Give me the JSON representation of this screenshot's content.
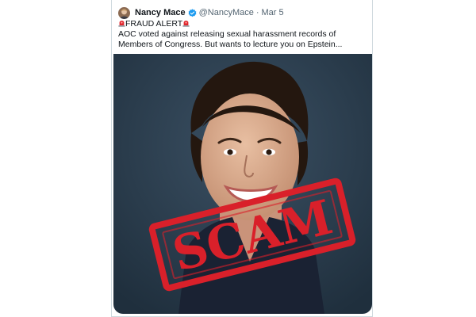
{
  "tweet": {
    "author": {
      "display_name": "Nancy Mace",
      "verified_icon": "verified-badge-icon",
      "handle": "@NancyMace",
      "separator": "·",
      "timestamp": "Mar 5"
    },
    "body": {
      "alert_icon": "police-siren-icon",
      "alert_label": "FRAUD ALERT",
      "line": "AOC voted against releasing sexual harassment records of Members of Congress. But wants to lecture you on Epstein..."
    },
    "media": {
      "kind": "photo",
      "stamp_text": "SCAM",
      "stamp_color": "#d9202a"
    }
  },
  "colors": {
    "verified_blue": "#1d9bf0",
    "text_primary": "#0f1419",
    "text_secondary": "#536471",
    "photo_background": "#2a3d4d"
  }
}
